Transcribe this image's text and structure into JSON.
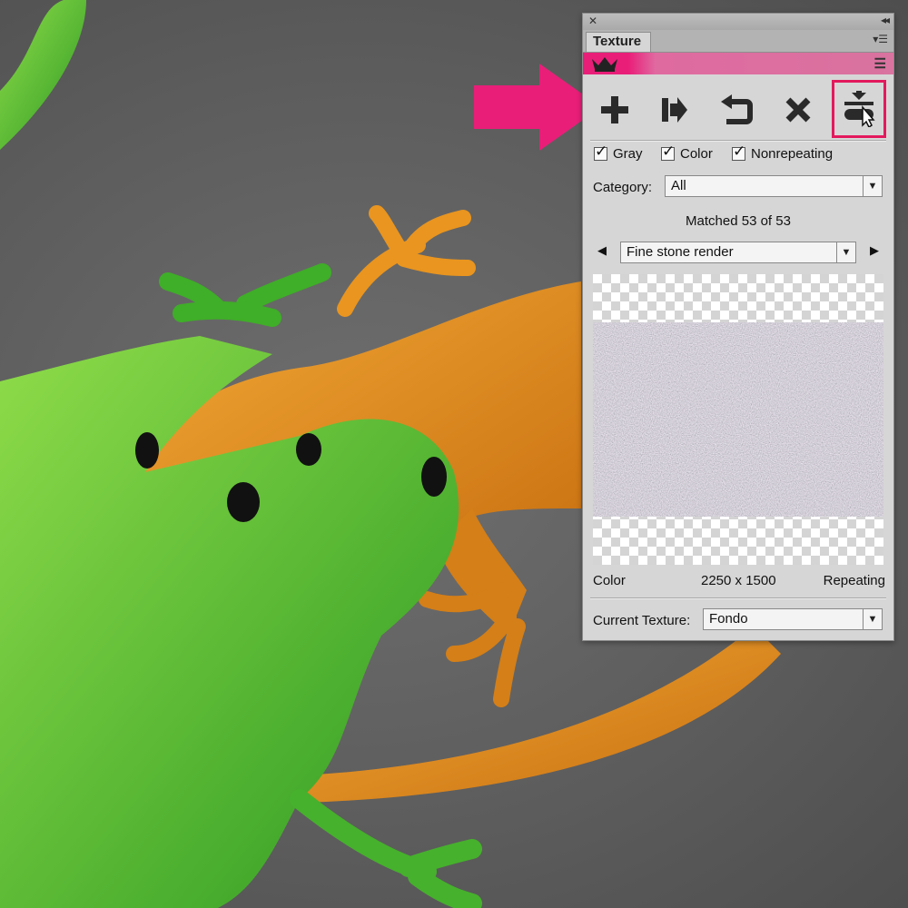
{
  "panel": {
    "tab_title": "Texture",
    "checkboxes": [
      {
        "label": "Gray",
        "checked": true
      },
      {
        "label": "Color",
        "checked": true
      },
      {
        "label": "Nonrepeating",
        "checked": true
      }
    ],
    "category": {
      "label": "Category:",
      "value": "All"
    },
    "matched_text": "Matched 53 of 53",
    "texture_select": {
      "value": "Fine stone render"
    },
    "info": {
      "type": "Color",
      "dimensions": "2250 x 1500",
      "tiling": "Repeating"
    },
    "current_texture": {
      "label": "Current Texture:",
      "value": "Fondo"
    },
    "toolbar": [
      "plus-icon",
      "add-to-icon",
      "undo-icon",
      "delete-icon",
      "apply-texture-icon"
    ]
  },
  "colors": {
    "accent_pink": "#e91e79",
    "highlight_border": "#e3195d",
    "panel_bg": "#d6d6d6",
    "lizard_green": "#3fae28",
    "lizard_orange": "#e0891a"
  }
}
